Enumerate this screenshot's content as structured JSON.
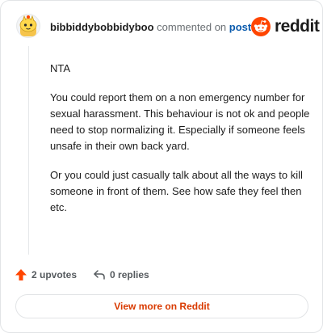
{
  "header": {
    "username": "bibbiddybobbidyboo",
    "commented_on": "commented on",
    "post_link": "post",
    "brand": "reddit"
  },
  "comment": {
    "paragraphs": [
      "NTA",
      "You could report them on a non emergency number for sexual harassment. This behaviour is not ok and people need to stop normalizing it. Especially if someone feels unsafe in their own back yard.",
      "Or you could just casually talk about all the ways to kill someone in front of them. See how safe they feel then etc."
    ]
  },
  "actions": {
    "upvotes": "2 upvotes",
    "replies": "0 replies"
  },
  "footer": {
    "view_more": "View more on Reddit"
  },
  "icons": {
    "avatar": "snoo-avatar-icon",
    "logo": "reddit-logo-icon",
    "upvote": "upvote-arrow-icon",
    "reply": "reply-arrow-icon"
  },
  "colors": {
    "upvote": "#ff4500",
    "link": "#0b5bad",
    "view_more": "#d93a00",
    "text": "#1c1c1c",
    "muted": "#6a6f73"
  }
}
